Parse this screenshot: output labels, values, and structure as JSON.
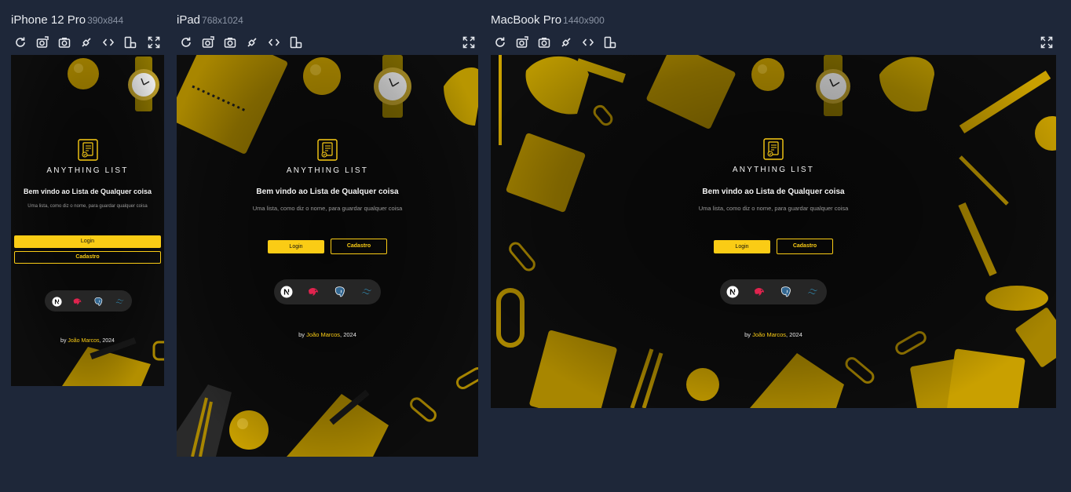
{
  "devices": [
    {
      "name": "iPhone 12 Pro",
      "size": "390x844"
    },
    {
      "name": "iPad",
      "size": "768x1024"
    },
    {
      "name": "MacBook Pro",
      "size": "1440x900"
    }
  ],
  "toolbar_icons": [
    "refresh-icon",
    "screenshot-settings-icon",
    "camera-icon",
    "sync-icon",
    "code-icon",
    "rotate-icon",
    "fullscreen-icon"
  ],
  "app": {
    "title": "ANYTHING LIST",
    "welcome": "Bem vindo ao Lista de Qualquer coisa",
    "subtitle": "Uma lista, como diz o nome, para guardar qualquer coisa",
    "login_label": "Login",
    "signup_label": "Cadastro",
    "tech_stack": [
      "nextjs-icon",
      "nestjs-icon",
      "postgresql-icon",
      "tailwind-icon"
    ],
    "credit_prefix": "by ",
    "credit_author": "João Marcos",
    "credit_suffix": ", 2024"
  },
  "colors": {
    "accent": "#facc15",
    "page_bg": "#1e2739",
    "screen_bg": "#0d0d0d",
    "pill_bg": "#262626"
  }
}
